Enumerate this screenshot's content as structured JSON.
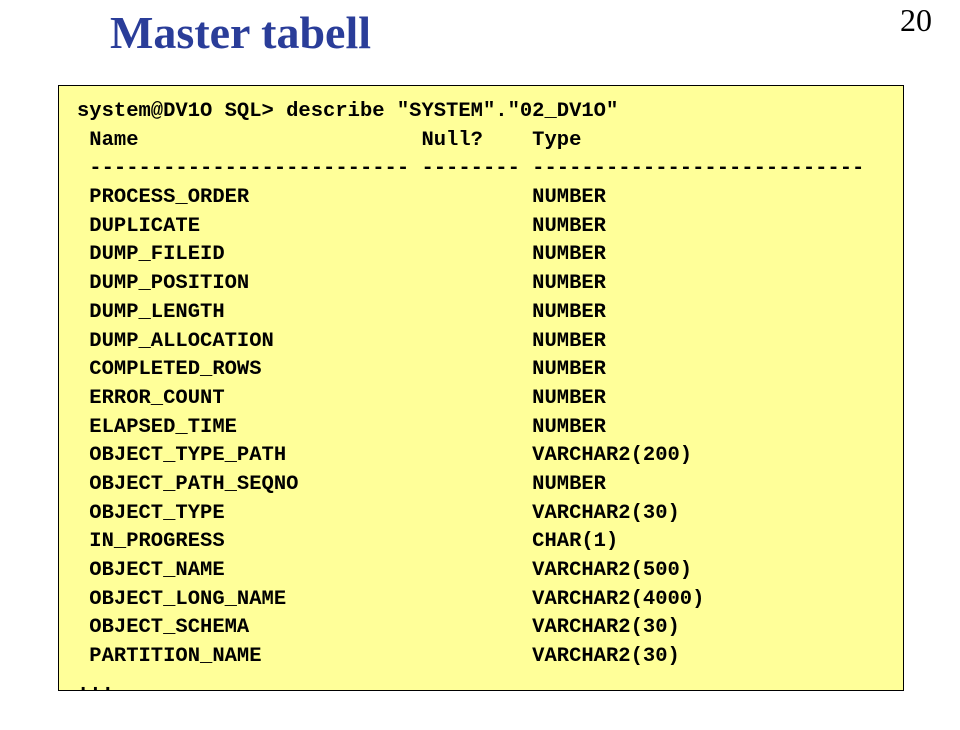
{
  "title": "Master tabell",
  "page_number": "20",
  "code": {
    "prompt_line": "system@DV1O SQL> describe \"SYSTEM\".\"02_DV1O\"",
    "header_name": " Name",
    "header_null": "Null?",
    "header_type": "Type",
    "separator": " -------------------------- -------- ---------------------------",
    "rows": [
      {
        "name": " PROCESS_ORDER",
        "type": "NUMBER"
      },
      {
        "name": " DUPLICATE",
        "type": "NUMBER"
      },
      {
        "name": " DUMP_FILEID",
        "type": "NUMBER"
      },
      {
        "name": " DUMP_POSITION",
        "type": "NUMBER"
      },
      {
        "name": " DUMP_LENGTH",
        "type": "NUMBER"
      },
      {
        "name": " DUMP_ALLOCATION",
        "type": "NUMBER"
      },
      {
        "name": " COMPLETED_ROWS",
        "type": "NUMBER"
      },
      {
        "name": " ERROR_COUNT",
        "type": "NUMBER"
      },
      {
        "name": " ELAPSED_TIME",
        "type": "NUMBER"
      },
      {
        "name": " OBJECT_TYPE_PATH",
        "type": "VARCHAR2(200)"
      },
      {
        "name": " OBJECT_PATH_SEQNO",
        "type": "NUMBER"
      },
      {
        "name": " OBJECT_TYPE",
        "type": "VARCHAR2(30)"
      },
      {
        "name": " IN_PROGRESS",
        "type": "CHAR(1)"
      },
      {
        "name": " OBJECT_NAME",
        "type": "VARCHAR2(500)"
      },
      {
        "name": " OBJECT_LONG_NAME",
        "type": "VARCHAR2(4000)"
      },
      {
        "name": " OBJECT_SCHEMA",
        "type": "VARCHAR2(30)"
      },
      {
        "name": " PARTITION_NAME",
        "type": "VARCHAR2(30)"
      }
    ],
    "ellipsis": "..."
  }
}
